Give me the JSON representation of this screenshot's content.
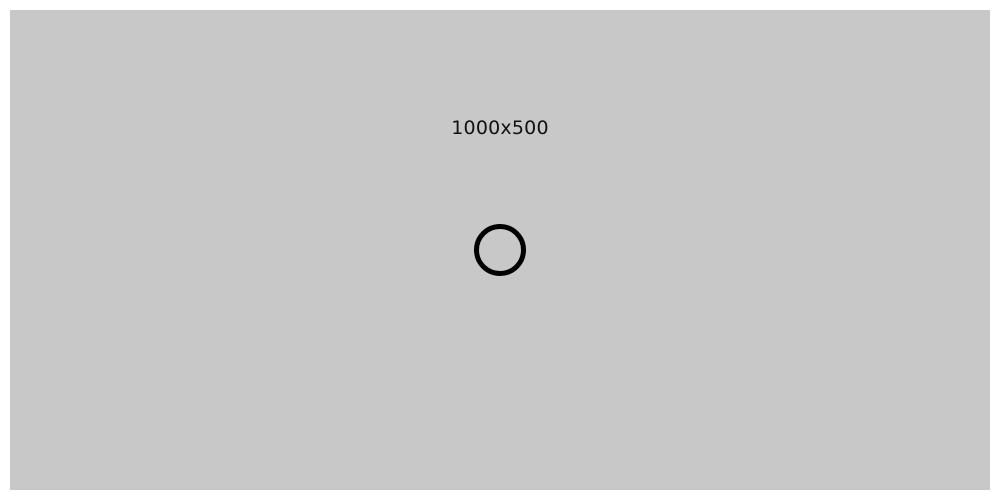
{
  "placeholder": {
    "dimension_label": "1000x500",
    "background_color": "#c8c8c8",
    "icon": "circle-outline-icon",
    "icon_color": "#000000"
  }
}
